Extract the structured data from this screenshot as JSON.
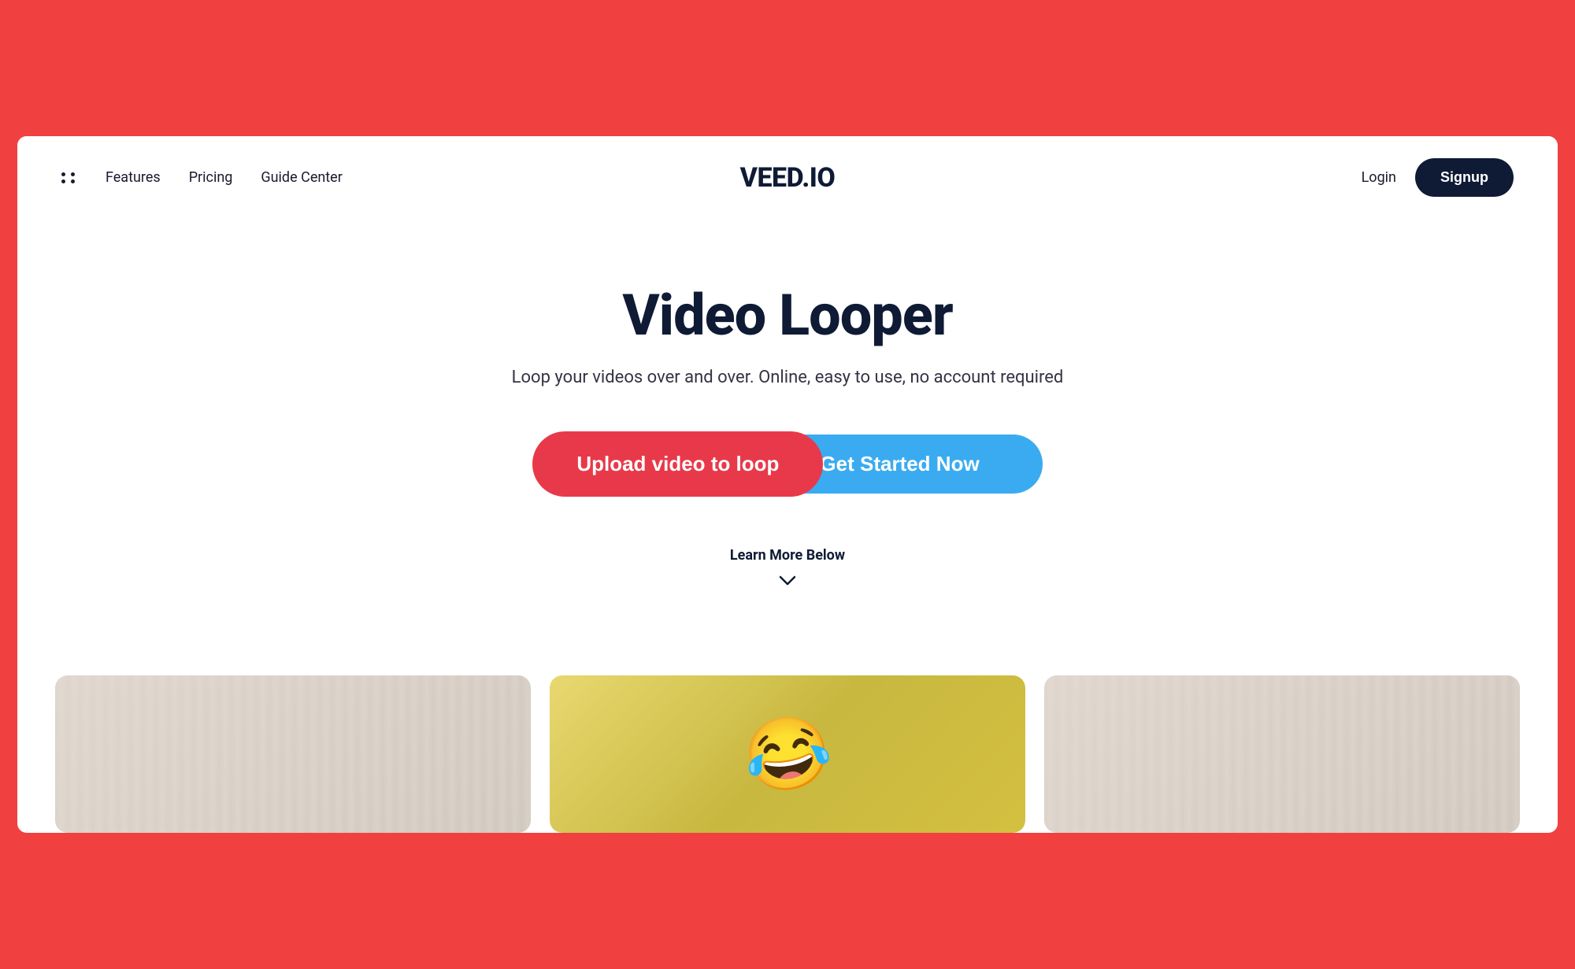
{
  "colors": {
    "brand_dark": "#0f1b35",
    "upload_btn_bg": "#e8394a",
    "get_started_bg": "#3aabf0",
    "page_bg": "#f04040",
    "white": "#ffffff"
  },
  "navbar": {
    "grid_icon_label": "grid-icon",
    "features_label": "Features",
    "pricing_label": "Pricing",
    "guide_center_label": "Guide Center",
    "logo_text": "VEED.IO",
    "login_label": "Login",
    "signup_label": "Signup"
  },
  "hero": {
    "title": "Video Looper",
    "subtitle": "Loop your videos over and over. Online, easy to use, no account required",
    "upload_btn_label": "Upload video to loop",
    "get_started_label": "Get Started Now",
    "learn_more_label": "Learn More Below",
    "arrow_icon": "→"
  },
  "video_section": {
    "thumb_left_alt": "video thumbnail left",
    "thumb_center_alt": "video thumbnail center emoji",
    "thumb_right_alt": "video thumbnail right",
    "emoji": "😂"
  }
}
